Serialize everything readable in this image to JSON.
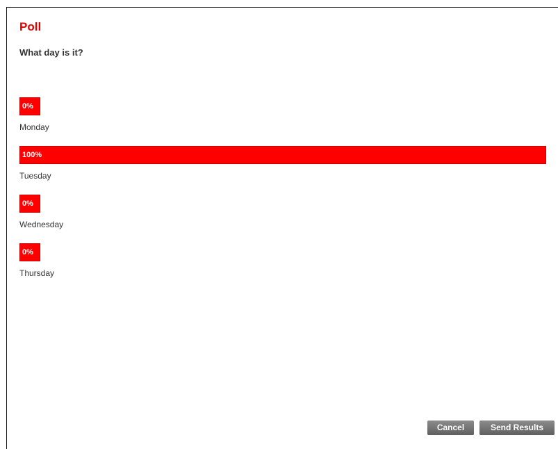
{
  "poll": {
    "title": "Poll",
    "question": "What day is it?",
    "options": [
      {
        "label": "Monday",
        "percent_label": "0%",
        "percent": 0
      },
      {
        "label": "Tuesday",
        "percent_label": "100%",
        "percent": 100
      },
      {
        "label": "Wednesday",
        "percent_label": "0%",
        "percent": 0
      },
      {
        "label": "Thursday",
        "percent_label": "0%",
        "percent": 0
      }
    ]
  },
  "actions": {
    "cancel_label": "Cancel",
    "send_label": "Send Results"
  },
  "colors": {
    "accent": "#ff0000",
    "title": "#e00000",
    "text": "#333333",
    "button": "#6f6f6f"
  }
}
